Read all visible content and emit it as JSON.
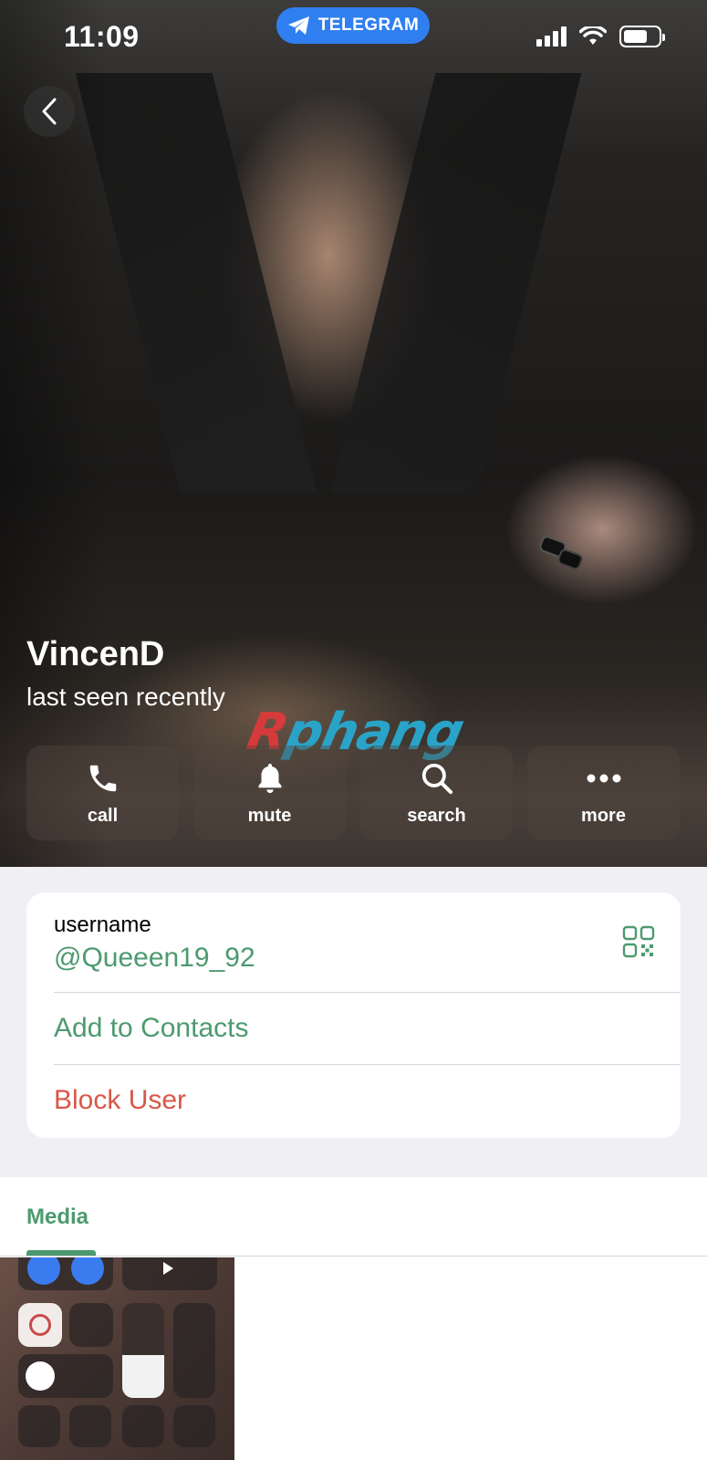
{
  "status_bar": {
    "time": "11:09",
    "app_pill": "TELEGRAM"
  },
  "profile": {
    "name": "VincenD",
    "last_seen": "last seen recently"
  },
  "watermark": {
    "part1": "R",
    "part2": "phang"
  },
  "actions": [
    {
      "label": "call",
      "icon": "phone-icon"
    },
    {
      "label": "mute",
      "icon": "bell-icon"
    },
    {
      "label": "search",
      "icon": "search-icon"
    },
    {
      "label": "more",
      "icon": "more-dots-icon"
    }
  ],
  "info": {
    "username_label": "username",
    "username_value": "@Queeen19_92",
    "add_contacts": "Add to Contacts",
    "block_user": "Block User"
  },
  "media": {
    "tab_label": "Media"
  },
  "colors": {
    "accent": "#4c9a6e",
    "danger": "#d9574a",
    "telegram_blue": "#2f7ff0"
  }
}
